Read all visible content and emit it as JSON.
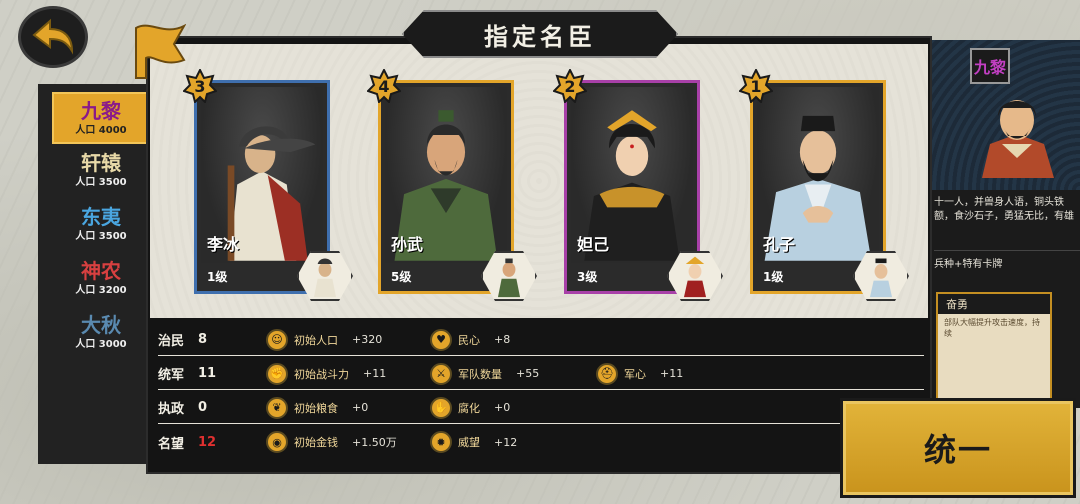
{
  "title": "指定名臣",
  "clans": [
    {
      "name": "九黎",
      "population": "人口 4000",
      "color": "#8a1a8a",
      "active": true
    },
    {
      "name": "轩辕",
      "population": "人口 3500",
      "color": "#e8d9a8",
      "active": false
    },
    {
      "name": "东夷",
      "population": "人口 3500",
      "color": "#4aa6e0",
      "active": false
    },
    {
      "name": "神农",
      "population": "人口 3200",
      "color": "#d84040",
      "active": false
    },
    {
      "name": "大秋",
      "population": "人口 3000",
      "color": "#5a8ab0",
      "active": false
    }
  ],
  "cards": [
    {
      "rank": "3",
      "name": "李冰",
      "level": "1级",
      "border": "#3f6fae"
    },
    {
      "rank": "4",
      "name": "孙武",
      "level": "5级",
      "border": "#e3a52a"
    },
    {
      "rank": "2",
      "name": "妲己",
      "level": "3级",
      "border": "#a840a8"
    },
    {
      "rank": "1",
      "name": "孔子",
      "level": "1级",
      "border": "#e3a52a"
    }
  ],
  "stats": [
    {
      "label": "治民",
      "value": "8",
      "effects": [
        {
          "icon": "population-icon",
          "name": "初始人口",
          "value": "+320"
        },
        {
          "icon": "heart-icon",
          "name": "民心",
          "value": "+8"
        }
      ]
    },
    {
      "label": "统军",
      "value": "11",
      "effects": [
        {
          "icon": "fist-icon",
          "name": "初始战斗力",
          "value": "+11"
        },
        {
          "icon": "army-icon",
          "name": "军队数量",
          "value": "+55"
        },
        {
          "icon": "helmet-icon",
          "name": "军心",
          "value": "+11"
        }
      ]
    },
    {
      "label": "执政",
      "value": "0",
      "effects": [
        {
          "icon": "grain-icon",
          "name": "初始粮食",
          "value": "+0"
        },
        {
          "icon": "corruption-icon",
          "name": "腐化",
          "value": "+0"
        }
      ]
    },
    {
      "label": "名望",
      "value": "12",
      "effects": [
        {
          "icon": "coin-icon",
          "name": "初始金钱",
          "value": "+1.50万"
        },
        {
          "icon": "prestige-icon",
          "name": "威望",
          "value": "+12"
        }
      ]
    }
  ],
  "side": {
    "clan_name": "九黎",
    "desc": "十一人，并兽身人语，铜头铁额，食沙石子，勇猛无比，有雄",
    "feature": "兵种+特有卡牌",
    "tip_title": "奋勇",
    "tip_body": "部队大幅提升攻击速度，持续"
  },
  "unify_label": "统一"
}
